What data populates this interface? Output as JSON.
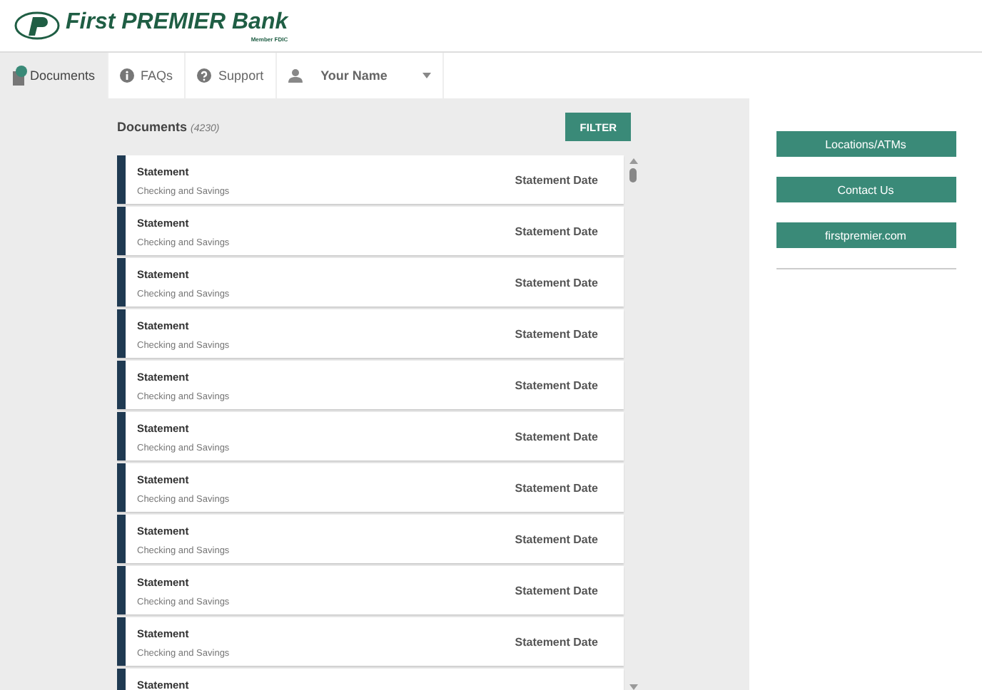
{
  "brand": {
    "name_first": "First",
    "name_premier": "PREMIER",
    "name_bank": "Bank",
    "member": "Member FDIC"
  },
  "nav": [
    {
      "label": "Documents",
      "selected": true,
      "kind": "documents"
    },
    {
      "label": "FAQs",
      "selected": false,
      "kind": "info"
    },
    {
      "label": "Support",
      "selected": false,
      "kind": "help"
    },
    {
      "label": "Your Name",
      "selected": false,
      "kind": "user"
    }
  ],
  "documents": {
    "title": "Documents",
    "count": "(4230)",
    "filter": "FILTER",
    "rows": [
      {
        "title": "Statement",
        "subtitle": "Checking and Savings",
        "date": "Statement Date"
      },
      {
        "title": "Statement",
        "subtitle": "Checking and Savings",
        "date": "Statement Date"
      },
      {
        "title": "Statement",
        "subtitle": "Checking and Savings",
        "date": "Statement Date"
      },
      {
        "title": "Statement",
        "subtitle": "Checking and Savings",
        "date": "Statement Date"
      },
      {
        "title": "Statement",
        "subtitle": "Checking and Savings",
        "date": "Statement Date"
      },
      {
        "title": "Statement",
        "subtitle": "Checking and Savings",
        "date": "Statement Date"
      },
      {
        "title": "Statement",
        "subtitle": "Checking and Savings",
        "date": "Statement Date"
      },
      {
        "title": "Statement",
        "subtitle": "Checking and Savings",
        "date": "Statement Date"
      },
      {
        "title": "Statement",
        "subtitle": "Checking and Savings",
        "date": "Statement Date"
      },
      {
        "title": "Statement",
        "subtitle": "Checking and Savings",
        "date": "Statement Date"
      },
      {
        "title": "Statement"
      }
    ]
  },
  "links": [
    "Locations/ATMs",
    "Contact Us",
    "firstpremier.com"
  ]
}
